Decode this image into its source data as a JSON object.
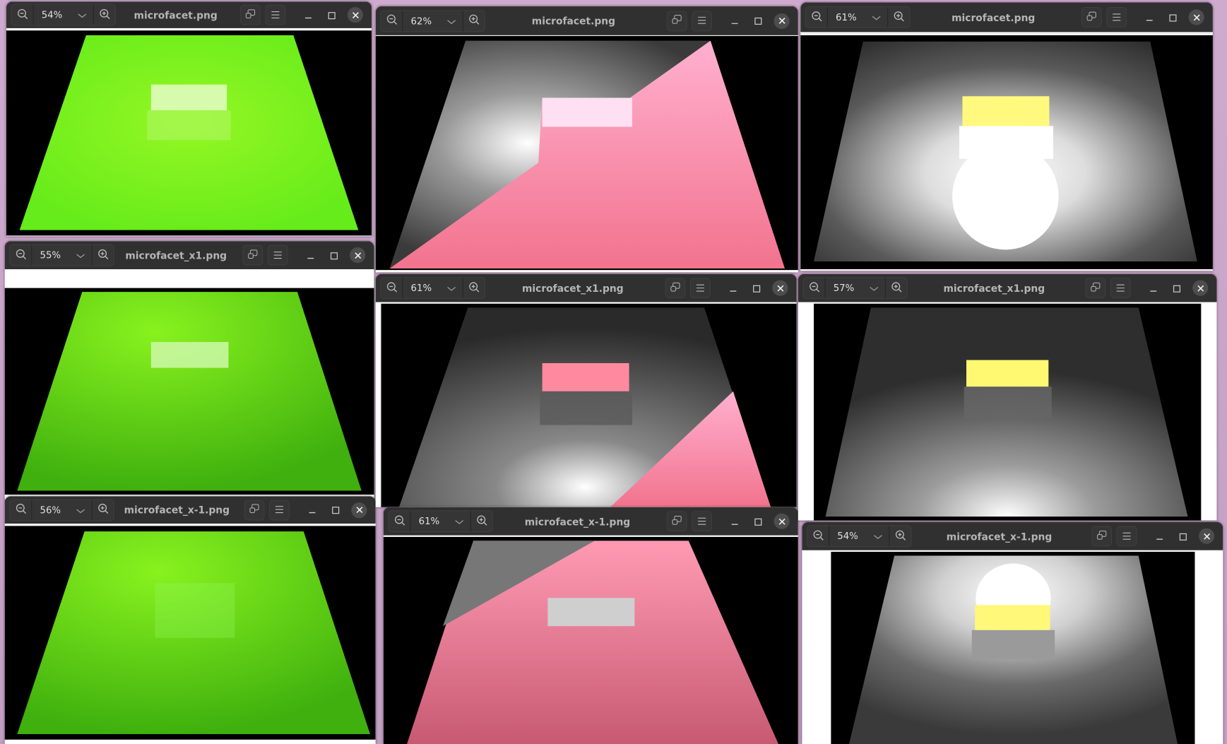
{
  "desktop": {
    "background_color": "#c7a3c6"
  },
  "windows": [
    {
      "id": "w1",
      "zoom": "54%",
      "title": "microfacet.png"
    },
    {
      "id": "w2",
      "zoom": "55%",
      "title": "microfacet_x1.png"
    },
    {
      "id": "w3",
      "zoom": "56%",
      "title": "microfacet_x-1.png"
    },
    {
      "id": "w4",
      "zoom": "62%",
      "title": "microfacet.png"
    },
    {
      "id": "w5",
      "zoom": "61%",
      "title": "microfacet_x1.png"
    },
    {
      "id": "w6",
      "zoom": "61%",
      "title": "microfacet_x-1.png"
    },
    {
      "id": "w7",
      "zoom": "61%",
      "title": "microfacet.png"
    },
    {
      "id": "w8",
      "zoom": "57%",
      "title": "microfacet_x1.png"
    },
    {
      "id": "w9",
      "zoom": "54%",
      "title": "microfacet_x-1.png"
    }
  ],
  "icons": {
    "zoom_out": "zoom-out-icon",
    "zoom_in": "zoom-in-icon",
    "chevron": "chevron-down-icon",
    "restore": "restore-icon",
    "menu": "hamburger-menu-icon",
    "minimize": "minimize-icon",
    "maximize": "maximize-icon",
    "close": "close-icon"
  },
  "colors": {
    "green": "#7af21e",
    "pink": "#ff8aa6",
    "yellow": "#fff878",
    "titlebar": "#303030"
  }
}
